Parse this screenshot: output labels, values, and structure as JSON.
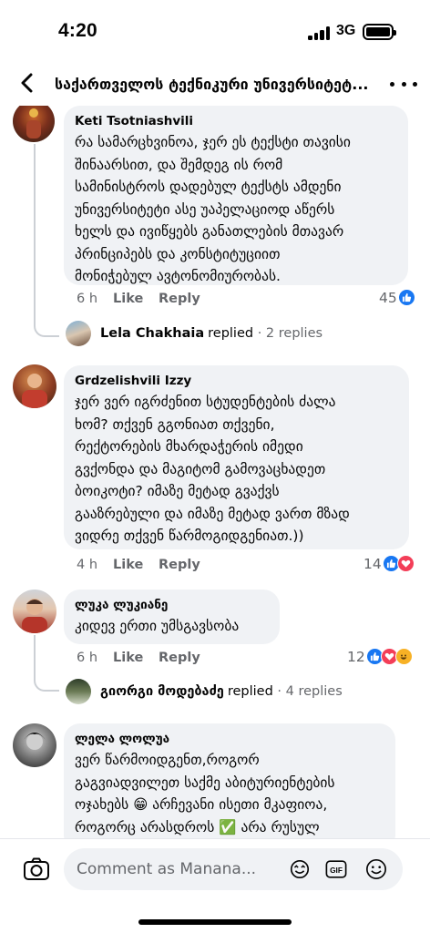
{
  "status_bar": {
    "time": "4:20",
    "network": "3G"
  },
  "header": {
    "title": "საქართველოს ტექნიკური უნივერსიტეტ..."
  },
  "comments": [
    {
      "author": "Keti Tsotniashvili",
      "lines": [
        "რა სამარცხვინოა, ჯერ ეს ტექსტი თავისი",
        "შინაარსით, და შემდეგ ის რომ",
        "სამინისტროს დადებულ ტექსტს ამდენი",
        "უნივერსიტეტი ასე უაპელაციოდ აწერს",
        "ხელს და ივიწყებს განათლების მთავარ",
        "პრინციპებს და კონსტიტუციით",
        "მონიჭებულ ავტონომიურობას."
      ],
      "time": "6 h",
      "like": "Like",
      "reply": "Reply",
      "reactions": "45",
      "replied_by": "Lela Chakhaia",
      "replied_word": "replied",
      "replies": "· 2 replies"
    },
    {
      "author": "Grdzelishvili Izzy",
      "lines": [
        "ჯერ ვერ იგრძენით სტუდენტების ძალა",
        "ხომ? თქვენ გგონიათ თქვენი,",
        "რექტორების მხარდაჭერის იმედი",
        "გვქონდა და მაგიტომ გამოვაცხადეთ",
        "ბოიკოტი? იმაზე მეტად გვაქვს",
        "გააზრებული და იმაზე მეტად ვართ მზად",
        "ვიდრე თქვენ წარმოგიდგენიათ.))"
      ],
      "time": "4 h",
      "like": "Like",
      "reply": "Reply",
      "reactions": "14"
    },
    {
      "author": "ლუკა ლუკიანე",
      "lines": [
        "კიდევ ერთი უმსგავსობა"
      ],
      "time": "6 h",
      "like": "Like",
      "reply": "Reply",
      "reactions": "12",
      "replied_by": "გიორგი მოდებაძე",
      "replied_word": "replied",
      "replies": "· 4 replies"
    },
    {
      "author": "ლელა ლოლუა",
      "lines": [
        "ვერ წარმოიდგენთ,როგორ",
        "გაგვიადვილეთ საქმე აბიტურიენტების",
        "ოჯახებს 😁 არჩევანი ისეთი მკაფიოა,",
        "როგორც არასდროს ✅ არა რუსულ"
      ]
    }
  ],
  "composer": {
    "placeholder": "Comment as Manana..."
  },
  "icons": [
    "back-icon",
    "more-icon",
    "like-reaction-icon",
    "love-reaction-icon",
    "haha-reaction-icon",
    "camera-icon",
    "sticker-icon",
    "gif-icon",
    "emoji-icon"
  ],
  "colors": {
    "like": "#1877f2",
    "love": "#f33e58",
    "haha": "#f7b125",
    "bubble": "#f0f2f5",
    "meta": "#65676b"
  }
}
